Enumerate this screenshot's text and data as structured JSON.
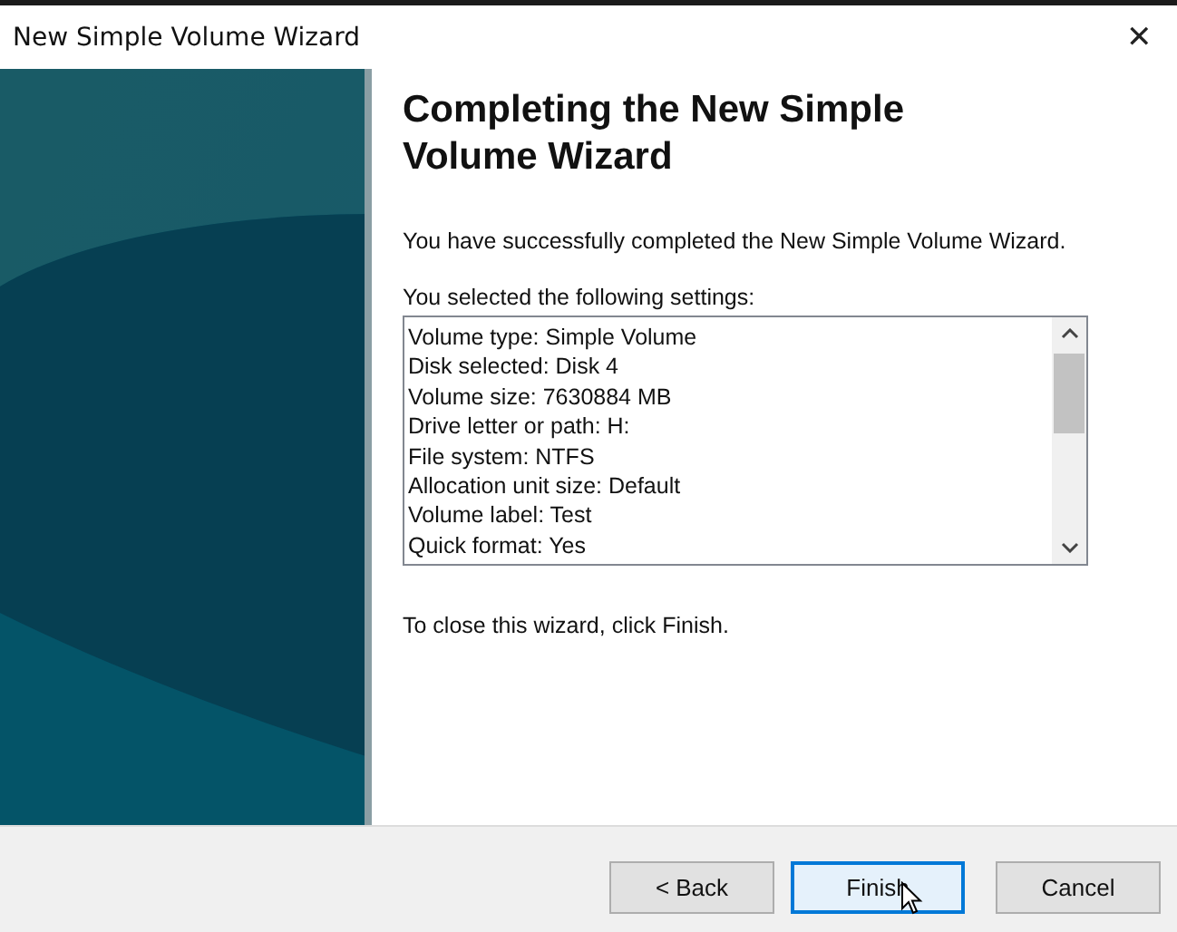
{
  "window": {
    "title": "New Simple Volume Wizard",
    "close": "✕"
  },
  "heading": "Completing the New Simple Volume Wizard",
  "message": "You have successfully completed the New Simple Volume Wizard.",
  "settings_label": "You selected the following settings:",
  "settings": [
    "Volume type: Simple Volume",
    "Disk selected: Disk 4",
    "Volume size: 7630884 MB",
    "Drive letter or path: H:",
    "File system: NTFS",
    "Allocation unit size: Default",
    "Volume label: Test",
    "Quick format: Yes"
  ],
  "footer_text": "To close this wizard, click Finish.",
  "buttons": [
    {
      "label": "< Back",
      "default": false
    },
    {
      "label": "Finish",
      "default": true
    },
    {
      "label": "Cancel",
      "default": false
    }
  ]
}
